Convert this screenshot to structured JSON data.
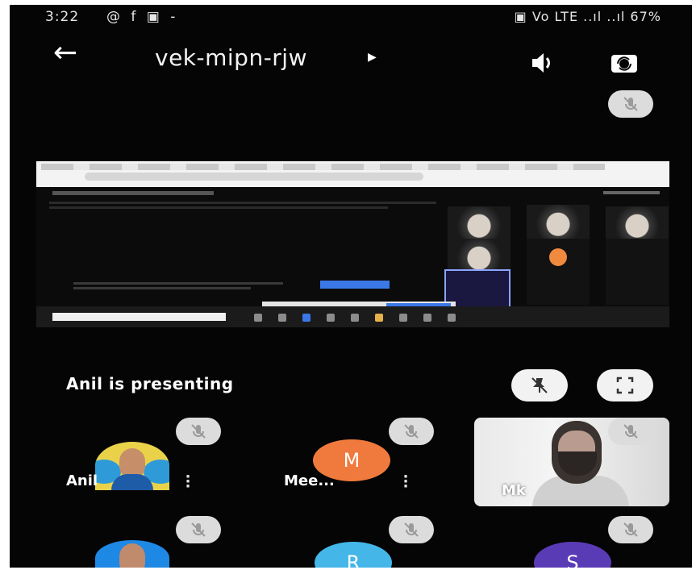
{
  "status_bar": {
    "time": "3:22",
    "notification_icons": "@ f ▣ -",
    "right_text": "▣ Vo LTE ..ıl ..ıl 67%"
  },
  "header": {
    "meeting_code": "vek-mipn-rjw"
  },
  "presenting": {
    "text": "Anil is presenting"
  },
  "participants": [
    {
      "name": "Anil",
      "type": "photo"
    },
    {
      "name": "Mee...",
      "type": "letter",
      "letter": "M",
      "color": "#f07a3d"
    },
    {
      "name": "Mk",
      "type": "video"
    },
    {
      "name": "",
      "type": "photo"
    },
    {
      "name": "",
      "type": "letter",
      "letter": "R",
      "color": "#45b6e8"
    },
    {
      "name": "",
      "type": "letter",
      "letter": "S",
      "color": "#5a3bb6"
    }
  ],
  "icons": {
    "back": "back-arrow-icon",
    "speaker": "speaker-icon",
    "camera_flip": "camera-switch-icon",
    "muted": "mic-off-icon",
    "unpin": "pin-off-icon",
    "fullscreen": "fullscreen-icon",
    "more": "more-vertical-icon"
  }
}
